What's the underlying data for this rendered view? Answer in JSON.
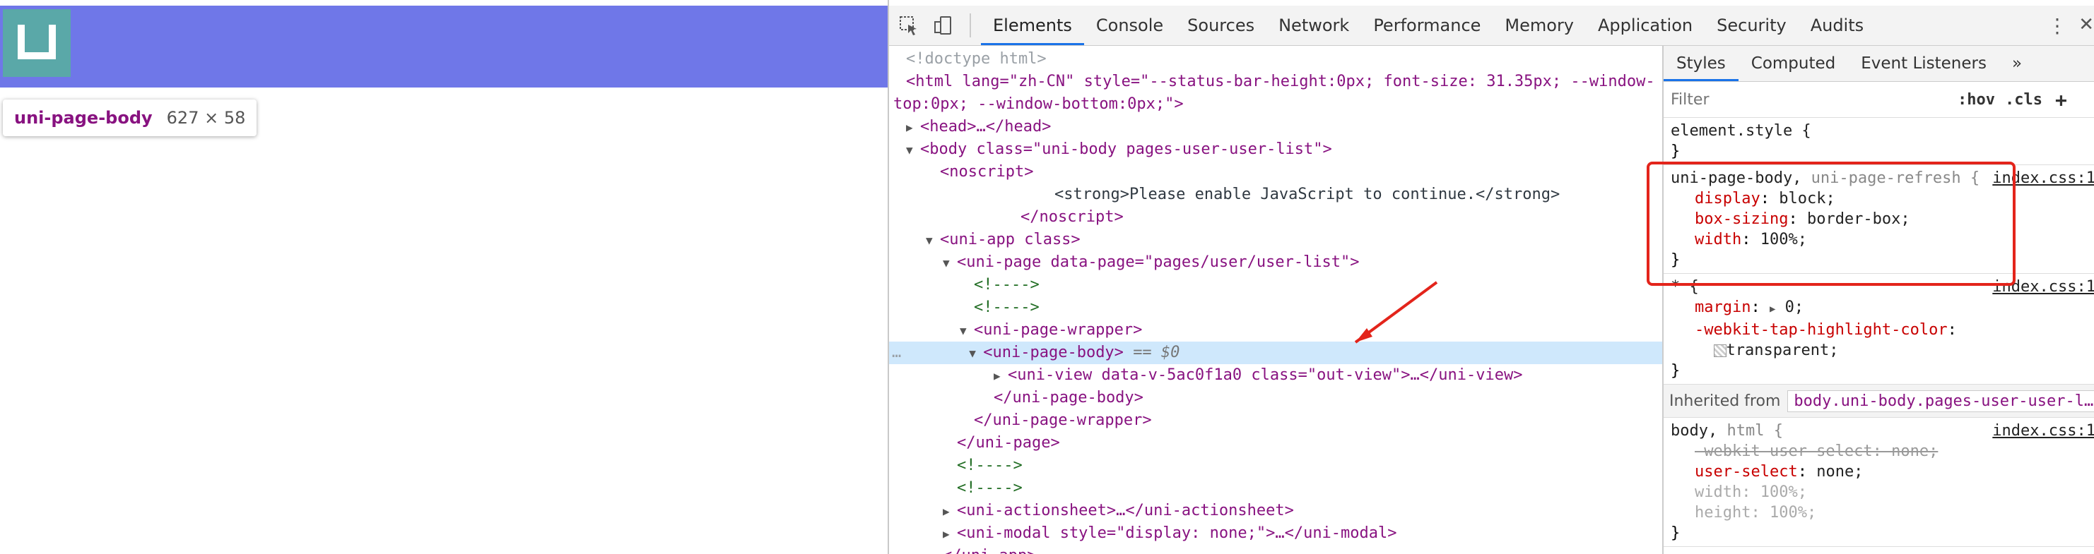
{
  "tooltip": {
    "tag": "uni-page-body",
    "size": "627 × 58"
  },
  "devtools": {
    "tabs": [
      "Elements",
      "Console",
      "Sources",
      "Network",
      "Performance",
      "Memory",
      "Application",
      "Security",
      "Audits"
    ],
    "active_tab": "Elements"
  },
  "tree": {
    "doctype": "<!doctype html>",
    "html_open_1": "<html lang=\"zh-CN\" style=\"--status-bar-height:0px; font-size: 31.35px; --window-",
    "html_open_2": "top:0px; --window-bottom:0px;\">",
    "head": "<head>…</head>",
    "body": "<body class=\"uni-body pages-user-user-list\">",
    "noscript_open": "<noscript>",
    "strong": "<strong>Please enable JavaScript to continue.</strong>",
    "noscript_close": "</noscript>",
    "uni_app": "<uni-app class>",
    "uni_page": "<uni-page data-page=\"pages/user/user-list\">",
    "comment": "<!---->",
    "wrapper_open": "<uni-page-wrapper>",
    "page_body": "<uni-page-body>",
    "selected_marker": "== $0",
    "uni_view": "<uni-view data-v-5ac0f1a0 class=\"out-view\">…</uni-view>",
    "page_body_close": "</uni-page-body>",
    "wrapper_close": "</uni-page-wrapper>",
    "page_close": "</uni-page>",
    "actionsheet": "<uni-actionsheet>…</uni-actionsheet>",
    "modal": "<uni-modal style=\"display: none;\">…</uni-modal>",
    "app_close": "</uni-app>",
    "dots": "…"
  },
  "styles": {
    "subtabs": [
      "Styles",
      "Computed",
      "Event Listeners",
      "»"
    ],
    "filter_placeholder": "Filter",
    "hov": ":hov",
    "cls": ".cls",
    "plus": "+",
    "element_style": "element.style {",
    "close_brace": "}",
    "rule1_selector": "uni-page-body,",
    "rule1_selector_dim": " uni-page-refresh {",
    "rule1_source": "index.css:1",
    "rule1_props": [
      {
        "name": "display",
        "value": "block;"
      },
      {
        "name": "box-sizing",
        "value": "border-box;"
      },
      {
        "name": "width",
        "value": "100%;"
      }
    ],
    "rule2_selector": "* {",
    "rule2_source": "index.css:1",
    "rule2_margin_name": "margin",
    "rule2_margin_value": "0;",
    "rule2_tap_name": "-webkit-tap-highlight-color",
    "rule2_tap_value": "transparent;",
    "inherited_label": "Inherited from",
    "inherited_target": "body.uni-body.pages-user-user-l…",
    "rule3_selector": "body,",
    "rule3_selector_dim": " html {",
    "rule3_source": "index.css:1",
    "rule3_p1": "-webkit-user-select: none;",
    "rule3_p2_name": "user-select",
    "rule3_p2_value": "none;",
    "rule3_p3": "width: 100%;",
    "rule3_p4": "height: 100%;"
  },
  "colors": {
    "highlight": "#6f77e8",
    "accent": "#1a73e8",
    "annotation": "#e3241b"
  }
}
